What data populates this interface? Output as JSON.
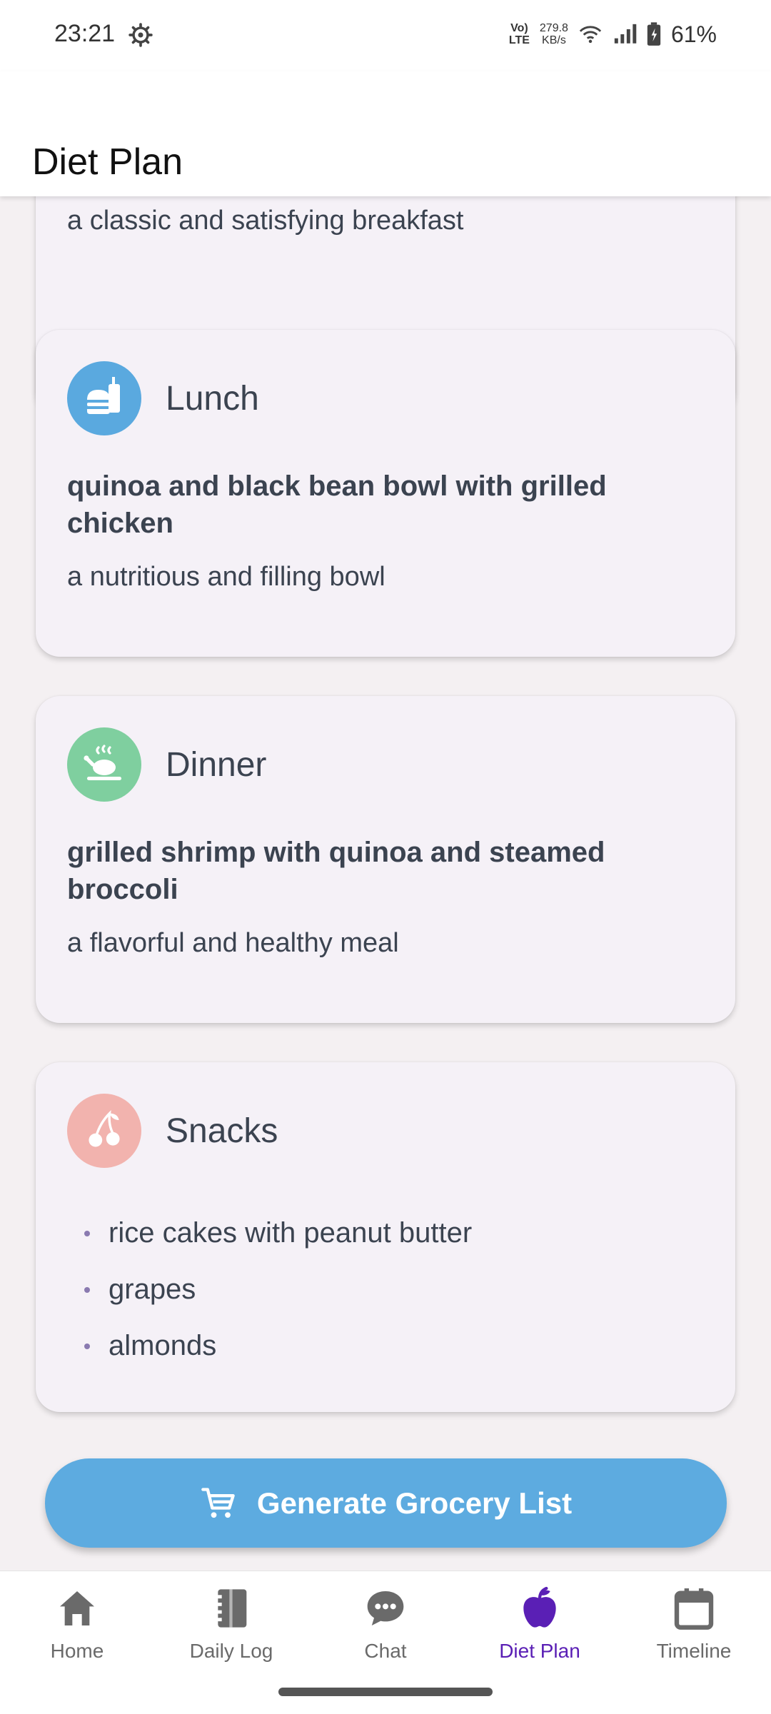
{
  "status_bar": {
    "time": "23:21",
    "volte": [
      "Vo)",
      "LTE"
    ],
    "net_speed": [
      "279.8",
      "KB/s"
    ],
    "battery": "61%"
  },
  "app_bar": {
    "title": "Diet Plan"
  },
  "meals": {
    "breakfast_partial": {
      "description": "a classic and satisfying breakfast"
    },
    "lunch": {
      "title": "Lunch",
      "dish": "quinoa and black bean bowl with grilled chicken",
      "description": "a nutritious and filling bowl",
      "icon": "burger-drink-icon",
      "icon_color": "#5aa9df"
    },
    "dinner": {
      "title": "Dinner",
      "dish": "grilled shrimp with quinoa and steamed broccoli",
      "description": "a flavorful and healthy meal",
      "icon": "roast-chicken-icon",
      "icon_color": "#7fcf9f"
    },
    "snacks": {
      "title": "Snacks",
      "items": [
        "rice cakes with peanut butter",
        "grapes",
        "almonds"
      ],
      "icon": "cherries-icon",
      "icon_color": "#f2b3ae"
    }
  },
  "grocery_button": {
    "label": "Generate Grocery List",
    "icon": "cart-icon",
    "color": "#5dabe0"
  },
  "bottom_nav": {
    "items": [
      {
        "label": "Home",
        "icon": "home-icon"
      },
      {
        "label": "Daily Log",
        "icon": "notebook-icon"
      },
      {
        "label": "Chat",
        "icon": "chat-bubble-icon"
      },
      {
        "label": "Diet Plan",
        "icon": "apple-icon",
        "active": true
      },
      {
        "label": "Timeline",
        "icon": "calendar-icon"
      }
    ],
    "active_color": "#5a1fb5",
    "inactive_color": "#6a6a6a"
  }
}
